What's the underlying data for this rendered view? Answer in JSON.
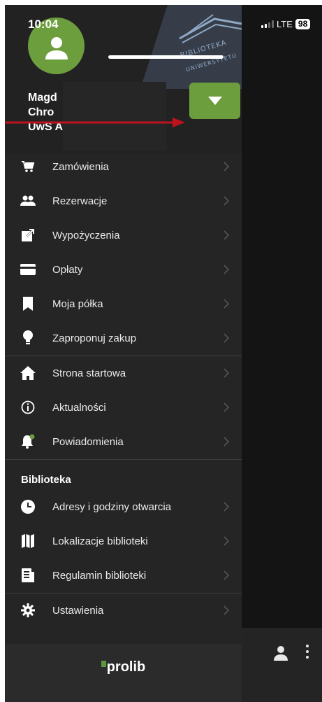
{
  "status_bar": {
    "time": "10:04",
    "network": "LTE",
    "battery": "98"
  },
  "header": {
    "user_line1": "Magd",
    "user_line2": "Chro",
    "user_line3": "UwS A",
    "banner_text1": "BIBLIOTEKA",
    "banner_text2": "UNIWERSYTETU",
    "accent_color": "#6d9e3e"
  },
  "menu": {
    "items": [
      {
        "label": "Zamówienia",
        "icon": "cart-icon"
      },
      {
        "label": "Rezerwacje",
        "icon": "people-icon"
      },
      {
        "label": "Wypożyczenia",
        "icon": "external-link-icon"
      },
      {
        "label": "Opłaty",
        "icon": "credit-card-icon"
      },
      {
        "label": "Moja półka",
        "icon": "bookmark-icon"
      },
      {
        "label": "Zaproponuj zakup",
        "icon": "lightbulb-icon"
      }
    ],
    "items2": [
      {
        "label": "Strona startowa",
        "icon": "home-icon"
      },
      {
        "label": "Aktualności",
        "icon": "info-icon"
      },
      {
        "label": "Powiadomienia",
        "icon": "bell-icon"
      }
    ],
    "section_title": "Biblioteka",
    "items3": [
      {
        "label": "Adresy i godziny otwarcia",
        "icon": "clock-icon"
      },
      {
        "label": "Lokalizacje biblioteki",
        "icon": "map-icon"
      },
      {
        "label": "Regulamin biblioteki",
        "icon": "document-icon"
      }
    ],
    "items4": [
      {
        "label": "Ustawienia",
        "icon": "gear-icon"
      }
    ]
  },
  "footer": {
    "brand": "prolib"
  }
}
